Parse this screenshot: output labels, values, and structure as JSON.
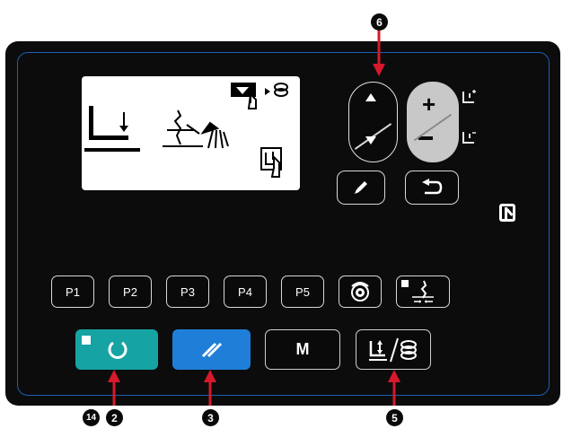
{
  "panel": {
    "p_buttons": [
      "P1",
      "P2",
      "P3",
      "P4",
      "P5"
    ],
    "mode_label": "M"
  },
  "callouts": {
    "up_down": "6",
    "ready": "14",
    "ready_led": "2",
    "reset": "3",
    "winder": "5"
  },
  "colors": {
    "panel_bg": "#0c0c0c",
    "frame": "#1d5fb4",
    "ready_button": "#16a3a4",
    "reset_button": "#1f7fd8",
    "callout_arrow": "#d6192b"
  },
  "icons": {
    "nfc": "nfc-icon",
    "edit": "pencil-icon",
    "back": "return-icon"
  }
}
